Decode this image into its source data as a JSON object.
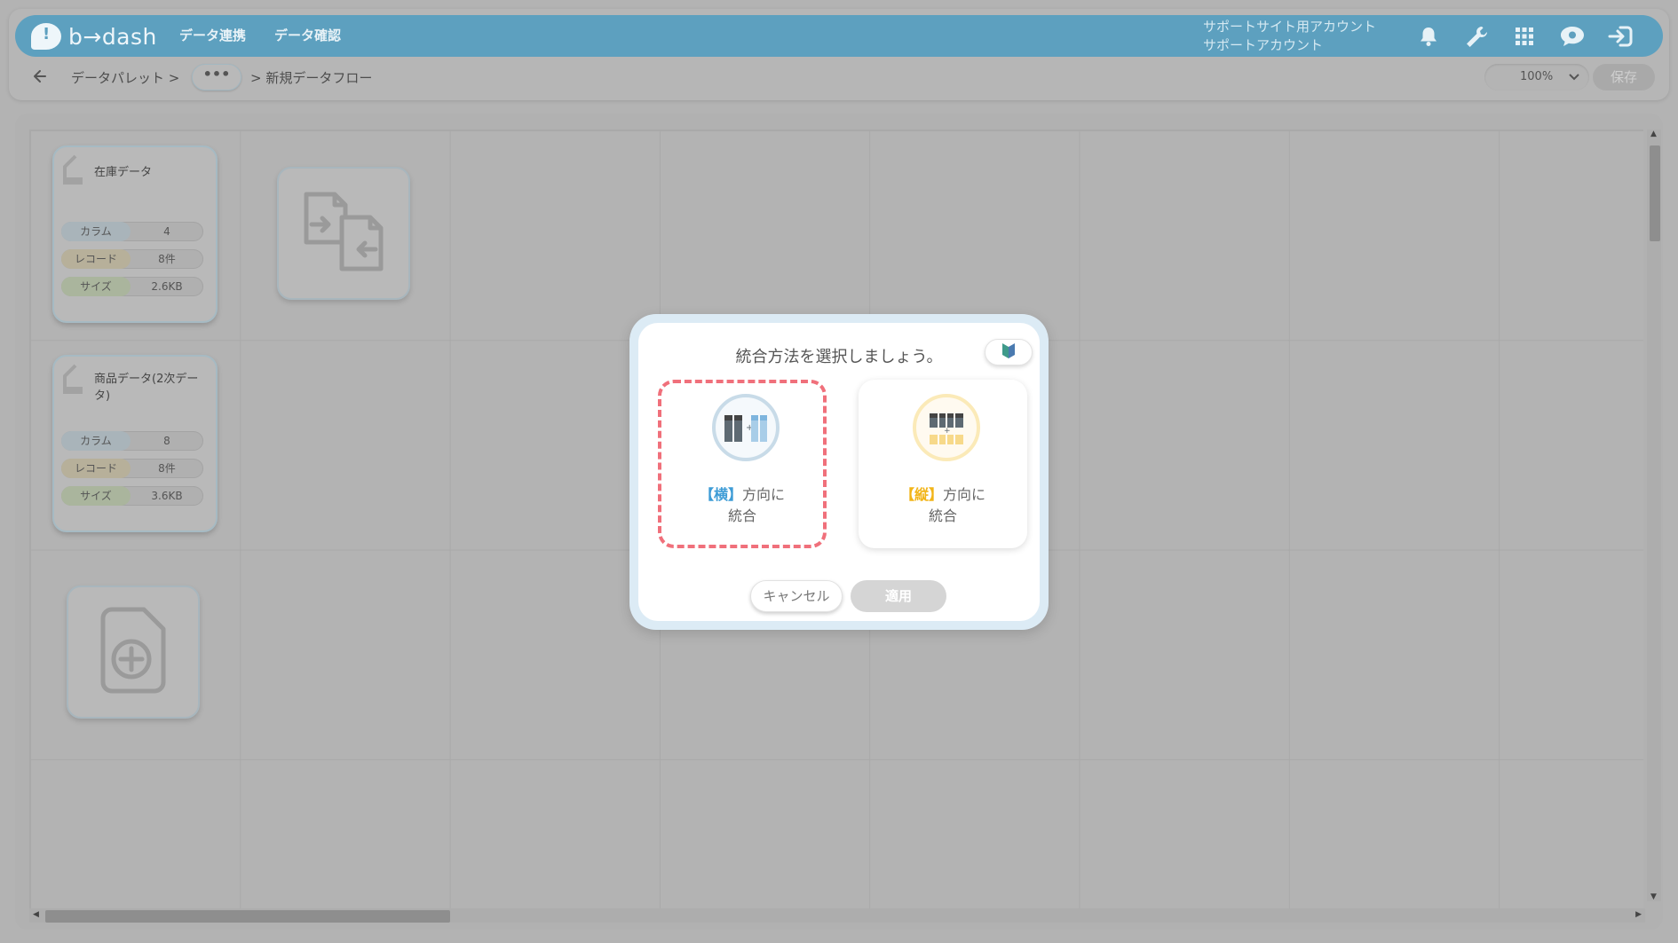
{
  "app": {
    "logo_text": "b→dash",
    "nav": [
      "データ連携",
      "データ確認"
    ],
    "account_line1": "サポートサイト用アカウント",
    "account_line2": "サポートアカウント",
    "icons": [
      "bell-icon",
      "wrench-icon",
      "grid-icon",
      "chat-icon",
      "logout-icon"
    ],
    "accent_color": "#5da0bf"
  },
  "breadcrumb": {
    "root": "データパレット >",
    "ellipsis": "•••",
    "current": "> 新規データフロー"
  },
  "toolbar": {
    "zoom": "100%",
    "save_label": "保存"
  },
  "cards": [
    {
      "title": "在庫データ",
      "stats": [
        {
          "label": "カラム",
          "value": "4"
        },
        {
          "label": "レコード",
          "value": "8件"
        },
        {
          "label": "サイズ",
          "value": "2.6KB"
        }
      ]
    },
    {
      "title": "商品データ(2次データ)",
      "stats": [
        {
          "label": "カラム",
          "value": "8"
        },
        {
          "label": "レコード",
          "value": "8件"
        },
        {
          "label": "サイズ",
          "value": "3.6KB"
        }
      ]
    }
  ],
  "dialog": {
    "title": "統合方法を選択しましょう。",
    "options": [
      {
        "accent": "【横】",
        "text_line1": "方向に",
        "text_line2": "統合",
        "selected": true
      },
      {
        "accent": "【縦】",
        "text_line1": "方向に",
        "text_line2": "統合",
        "selected": false
      }
    ],
    "cancel_label": "キャンセル",
    "apply_label": "適用"
  }
}
